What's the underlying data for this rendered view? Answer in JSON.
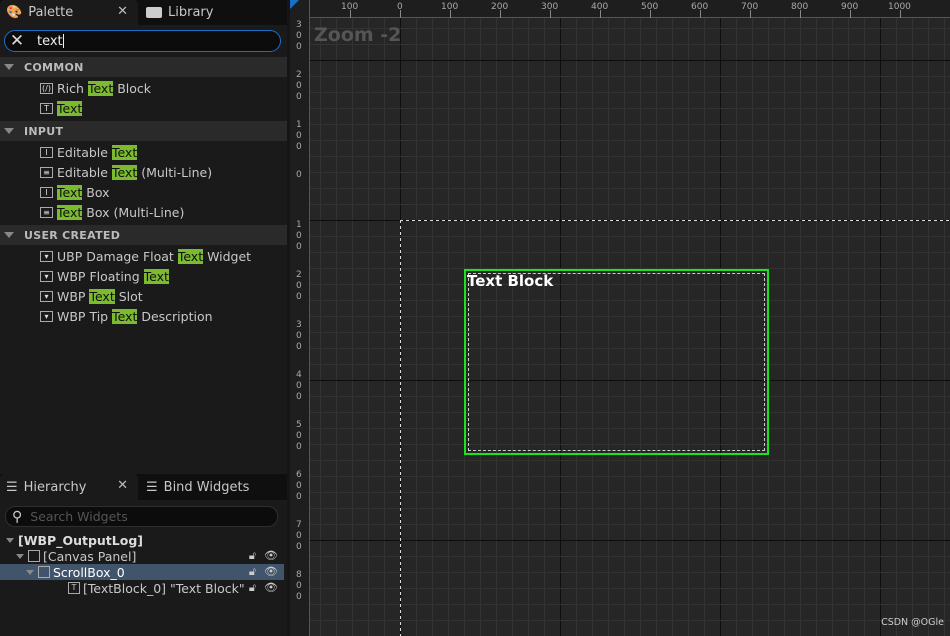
{
  "palette": {
    "tab_label": "Palette",
    "library_label": "Library",
    "search_value": "text",
    "categories": [
      {
        "label": "COMMON",
        "items": [
          {
            "icon": "rich-text-icon",
            "glyph": "(/)",
            "pre": "Rich ",
            "match": "Text",
            "post": " Block"
          },
          {
            "icon": "text-icon",
            "glyph": "T",
            "pre": "",
            "match": "Text",
            "post": ""
          }
        ]
      },
      {
        "label": "INPUT",
        "items": [
          {
            "icon": "editable-text-icon",
            "glyph": "I",
            "pre": "Editable ",
            "match": "Text",
            "post": ""
          },
          {
            "icon": "editable-multiline-icon",
            "glyph": "≡",
            "pre": "Editable ",
            "match": "Text",
            "post": " (Multi-Line)"
          },
          {
            "icon": "text-box-icon",
            "glyph": "I",
            "pre": "",
            "match": "Text",
            "post": " Box"
          },
          {
            "icon": "text-box-multiline-icon",
            "glyph": "≡",
            "pre": "",
            "match": "Text",
            "post": " Box (Multi-Line)"
          }
        ]
      },
      {
        "label": "USER CREATED",
        "items": [
          {
            "icon": "user-widget-icon",
            "glyph": "▾",
            "pre": "UBP Damage Float ",
            "match": "Text",
            "post": " Widget"
          },
          {
            "icon": "user-widget-icon",
            "glyph": "▾",
            "pre": "WBP Floating ",
            "match": "Text",
            "post": ""
          },
          {
            "icon": "user-widget-icon",
            "glyph": "▾",
            "pre": "WBP ",
            "match": "Text",
            "post": " Slot"
          },
          {
            "icon": "user-widget-icon",
            "glyph": "▾",
            "pre": "WBP Tip ",
            "match": "Text",
            "post": " Description"
          }
        ]
      }
    ]
  },
  "hierarchy": {
    "tab_label": "Hierarchy",
    "bind_label": "Bind Widgets",
    "search_placeholder": "Search Widgets",
    "rows": [
      {
        "label": "[WBP_OutputLog]",
        "depth": 0,
        "bold": true
      },
      {
        "label": "[Canvas Panel]",
        "depth": 1
      },
      {
        "label": "ScrollBox_0",
        "depth": 2,
        "selected": true
      },
      {
        "label": "[TextBlock_0] \"Text Block\"",
        "depth": 3
      }
    ]
  },
  "designer": {
    "zoom_label": "Zoom -2",
    "text_block_label": "Text Block",
    "watermark": "CSDN @OGle",
    "ruler_x": [
      "100",
      "0",
      "100",
      "200",
      "300",
      "400",
      "500",
      "600",
      "700",
      "800",
      "900",
      "1000"
    ],
    "ruler_y": [
      "300",
      "200",
      "100",
      "0",
      "100",
      "200",
      "300",
      "400",
      "500",
      "600",
      "700",
      "800"
    ]
  },
  "colors": {
    "highlight": "#7bbb2e",
    "selection": "#40546c",
    "focus": "#1b6fc9",
    "widget_border": "#19e619"
  }
}
